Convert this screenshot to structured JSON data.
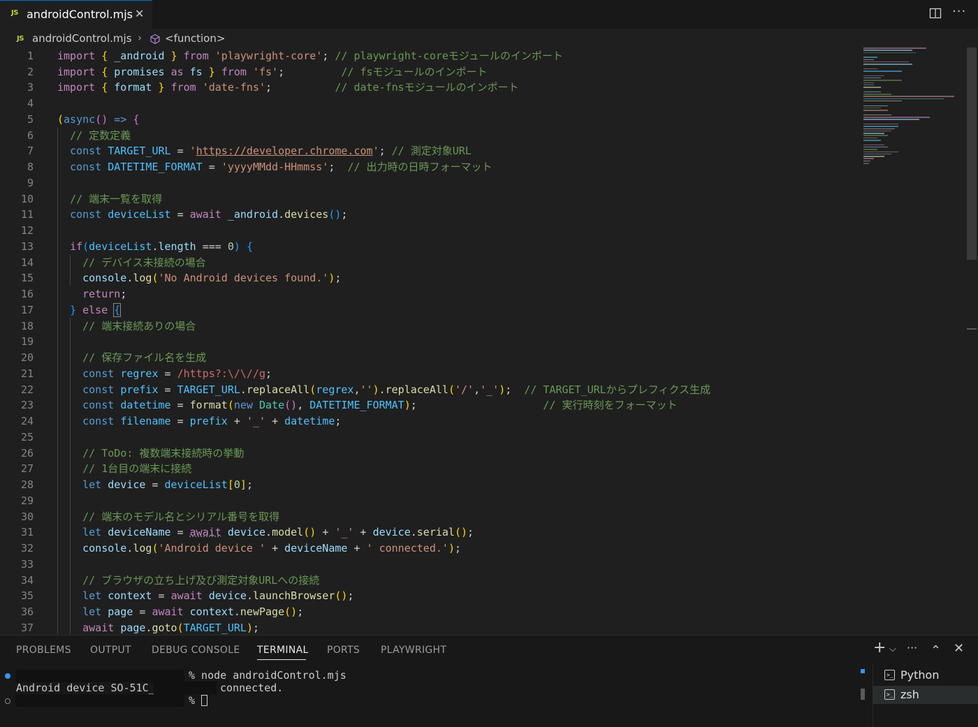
{
  "tab": {
    "badge": "JS",
    "title": "androidControl.mjs",
    "close": "✕"
  },
  "breadcrumb": {
    "badge": "JS",
    "file": "androidControl.mjs",
    "separator": "›",
    "symbol": "<function>"
  },
  "editor": {
    "line_numbers": [
      "1",
      "2",
      "3",
      "4",
      "5",
      "6",
      "7",
      "8",
      "9",
      "10",
      "11",
      "12",
      "13",
      "14",
      "15",
      "16",
      "17",
      "18",
      "19",
      "20",
      "21",
      "22",
      "23",
      "24",
      "25",
      "26",
      "27",
      "28",
      "29",
      "30",
      "31",
      "32",
      "33",
      "34",
      "35",
      "36",
      "37"
    ]
  },
  "panel": {
    "tabs": [
      "PROBLEMS",
      "OUTPUT",
      "DEBUG CONSOLE",
      "TERMINAL",
      "PORTS",
      "PLAYWRIGHT"
    ],
    "active_tab": "TERMINAL",
    "actions": {
      "add": "+",
      "dropdown": "⌵",
      "more": "···",
      "maximize": "⌃",
      "close": "✕"
    }
  },
  "terminal": {
    "line1": "% node androidControl.mjs",
    "line2_left": "Android device SO-51C_",
    "line2_right": "connected.",
    "line3": "%",
    "sessions": [
      {
        "label": "Python",
        "selected": false
      },
      {
        "label": "zsh",
        "selected": true
      }
    ]
  },
  "colors": {
    "background": "#1f1f1f",
    "tabbar": "#181818",
    "keyword": "#c586c0",
    "storage": "#569cd6",
    "variable": "#9cdcfe",
    "constant": "#4fc1ff",
    "string": "#ce9178",
    "function": "#dcdcaa",
    "comment": "#6a9955",
    "number": "#b5cea8",
    "accent": "#0078d4"
  }
}
